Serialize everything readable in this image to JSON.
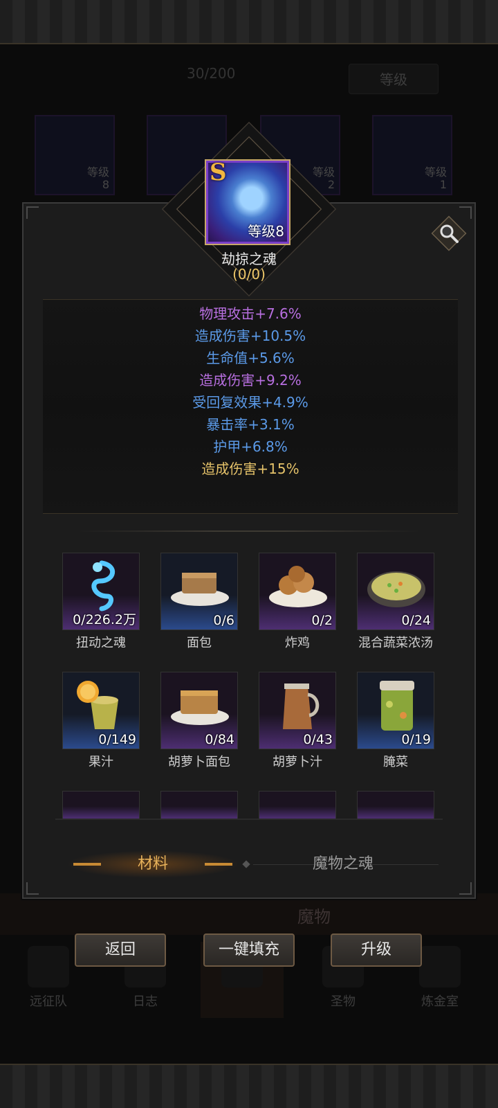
{
  "background": {
    "count": "30/200",
    "level_button": "等级",
    "cards": [
      {
        "level_label": "等级",
        "level": "8"
      },
      {
        "level_label": "",
        "level": ""
      },
      {
        "level_label": "等级",
        "level": "2"
      },
      {
        "level_label": "等级",
        "level": "1"
      }
    ],
    "bottom_tab_label": "魔物",
    "nav": [
      "远征队",
      "日志",
      "",
      "圣物",
      "炼金室"
    ]
  },
  "soul": {
    "rank_badge": "S",
    "level_text": "等级8",
    "name": "劫掠之魂",
    "progress": "(0/0)"
  },
  "stats": [
    {
      "text": "物理攻击+7.6%",
      "color": "#b86fe0"
    },
    {
      "text": "造成伤害+10.5%",
      "color": "#5b9ae8"
    },
    {
      "text": "生命值+5.6%",
      "color": "#5b9ae8"
    },
    {
      "text": "造成伤害+9.2%",
      "color": "#b86fe0"
    },
    {
      "text": "受回复效果+4.9%",
      "color": "#5b9ae8"
    },
    {
      "text": "暴击率+3.1%",
      "color": "#5b9ae8"
    },
    {
      "text": "护甲+6.8%",
      "color": "#5b9ae8"
    },
    {
      "text": "造成伤害+15%",
      "color": "#e6c36a"
    }
  ],
  "materials": [
    {
      "name": "扭动之魂",
      "count": "0/226.2万",
      "rarity": "purple",
      "icon": "blue-spirit-icon"
    },
    {
      "name": "面包",
      "count": "0/6",
      "rarity": "blue",
      "icon": "bread-icon"
    },
    {
      "name": "炸鸡",
      "count": "0/2",
      "rarity": "purple",
      "icon": "fried-chicken-icon"
    },
    {
      "name": "混合蔬菜浓汤",
      "count": "0/24",
      "rarity": "purple",
      "icon": "vegetable-soup-icon"
    },
    {
      "name": "果汁",
      "count": "0/149",
      "rarity": "blue",
      "icon": "juice-icon"
    },
    {
      "name": "胡萝卜面包",
      "count": "0/84",
      "rarity": "purple",
      "icon": "carrot-bread-icon"
    },
    {
      "name": "胡萝卜汁",
      "count": "0/43",
      "rarity": "purple",
      "icon": "carrot-juice-pitcher-icon"
    },
    {
      "name": "腌菜",
      "count": "0/19",
      "rarity": "blue",
      "icon": "pickle-jar-icon"
    }
  ],
  "tabs": {
    "active": "材料",
    "inactive": "魔物之魂"
  },
  "buttons": {
    "back": "返回",
    "autofill": "一键填充",
    "upgrade": "升级"
  }
}
